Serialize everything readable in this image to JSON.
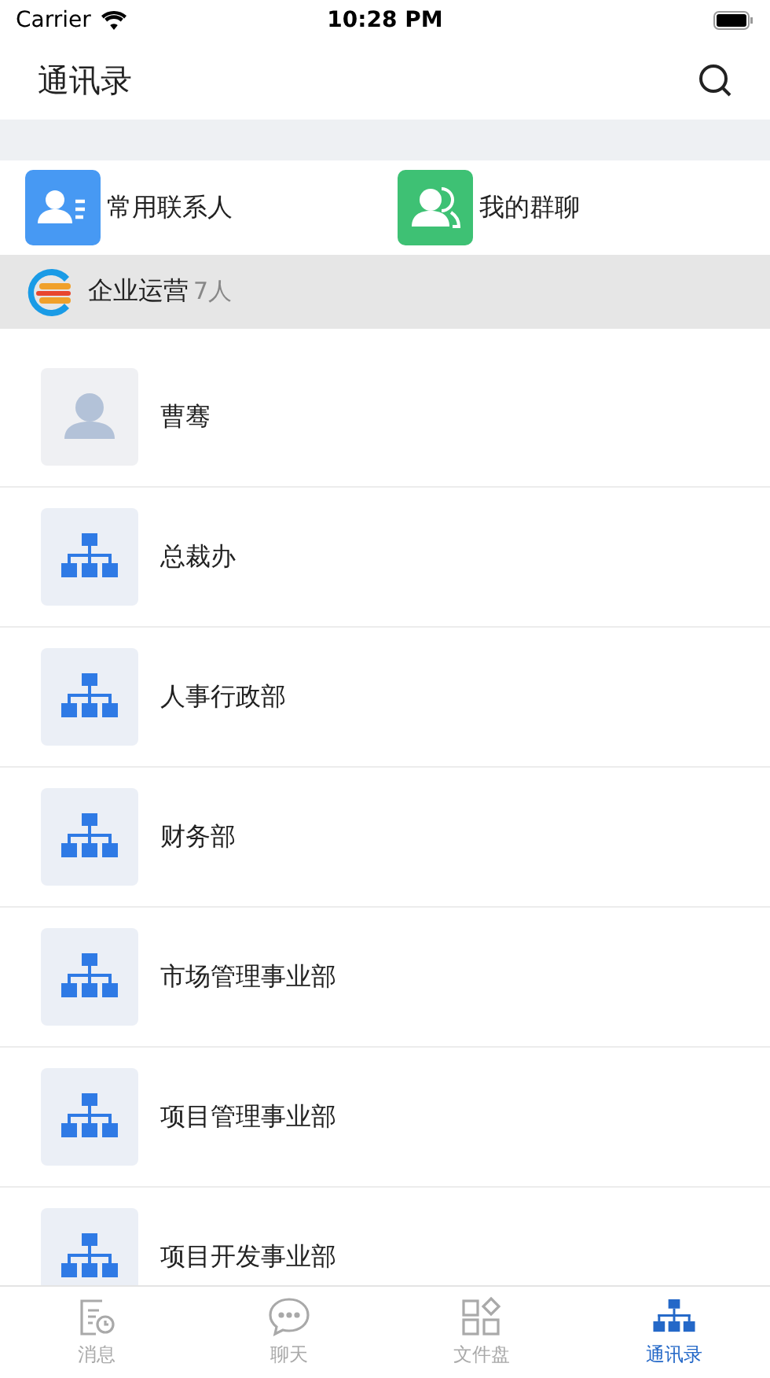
{
  "status_bar": {
    "carrier": "Carrier",
    "time": "10:28 PM"
  },
  "header": {
    "title": "通讯录"
  },
  "shortcuts": [
    {
      "kind": "contacts",
      "label": "常用联系人"
    },
    {
      "kind": "groups",
      "label": "我的群聊"
    }
  ],
  "organization": {
    "name": "企业运营",
    "count": "7人"
  },
  "items": [
    {
      "kind": "person",
      "name": "曹骞"
    },
    {
      "kind": "department",
      "name": "总裁办"
    },
    {
      "kind": "department",
      "name": "人事行政部"
    },
    {
      "kind": "department",
      "name": "财务部"
    },
    {
      "kind": "department",
      "name": "市场管理事业部"
    },
    {
      "kind": "department",
      "name": "项目管理事业部"
    },
    {
      "kind": "department",
      "name": "项目开发事业部"
    }
  ],
  "tabs": [
    {
      "kind": "messages",
      "label": "消息",
      "selected": false
    },
    {
      "kind": "chat",
      "label": "聊天",
      "selected": false
    },
    {
      "kind": "files",
      "label": "文件盘",
      "selected": false
    },
    {
      "kind": "contacts",
      "label": "通讯录",
      "selected": true
    }
  ]
}
